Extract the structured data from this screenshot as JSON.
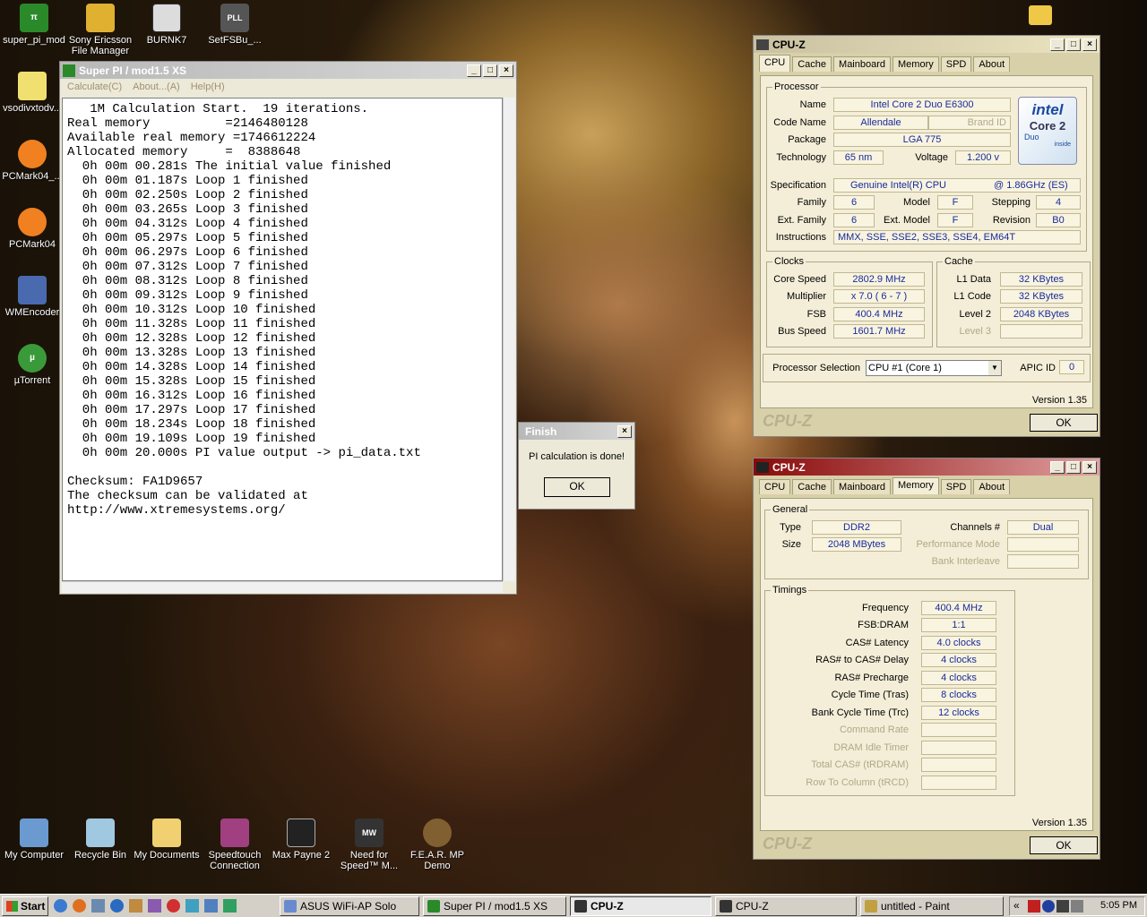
{
  "desktop_icons": {
    "top": [
      "super_pi_mod",
      "Sony Ericsson File Manager",
      "BURNK7",
      "SetFSBu_..."
    ],
    "left": [
      "vsodivxtodv...",
      "PCMark04_...",
      "PCMark04",
      "WMEncoder",
      "µTorrent"
    ],
    "bottom": [
      "My Computer",
      "Recycle Bin",
      "My Documents",
      "Speedtouch Connection",
      "Max Payne 2",
      "Need for Speed™ M...",
      "F.E.A.R. MP Demo"
    ]
  },
  "superpi": {
    "title": "Super PI / mod1.5 XS",
    "menu": [
      "Calculate(C)",
      "About...(A)",
      "Help(H)"
    ],
    "output": "   1M Calculation Start.  19 iterations.\nReal memory          =2146480128\nAvailable real memory =1746612224\nAllocated memory     =  8388648\n  0h 00m 00.281s The initial value finished\n  0h 00m 01.187s Loop 1 finished\n  0h 00m 02.250s Loop 2 finished\n  0h 00m 03.265s Loop 3 finished\n  0h 00m 04.312s Loop 4 finished\n  0h 00m 05.297s Loop 5 finished\n  0h 00m 06.297s Loop 6 finished\n  0h 00m 07.312s Loop 7 finished\n  0h 00m 08.312s Loop 8 finished\n  0h 00m 09.312s Loop 9 finished\n  0h 00m 10.312s Loop 10 finished\n  0h 00m 11.328s Loop 11 finished\n  0h 00m 12.328s Loop 12 finished\n  0h 00m 13.328s Loop 13 finished\n  0h 00m 14.328s Loop 14 finished\n  0h 00m 15.328s Loop 15 finished\n  0h 00m 16.312s Loop 16 finished\n  0h 00m 17.297s Loop 17 finished\n  0h 00m 18.234s Loop 18 finished\n  0h 00m 19.109s Loop 19 finished\n  0h 00m 20.000s PI value output -> pi_data.txt\n\nChecksum: FA1D9657\nThe checksum can be validated at\nhttp://www.xtremesystems.org/"
  },
  "finish": {
    "title": "Finish",
    "message": "PI calculation is done!",
    "ok": "OK"
  },
  "cpuz_tabs": [
    "CPU",
    "Cache",
    "Mainboard",
    "Memory",
    "SPD",
    "About"
  ],
  "cpuz1": {
    "title": "CPU-Z",
    "processor_label": "Processor",
    "name_label": "Name",
    "name": "Intel Core 2 Duo E6300",
    "codename_label": "Code Name",
    "codename": "Allendale",
    "brandid_label": "Brand ID",
    "package_label": "Package",
    "package": "LGA 775",
    "tech_label": "Technology",
    "tech": "65 nm",
    "voltage_label": "Voltage",
    "voltage": "1.200 v",
    "spec_label": "Specification",
    "spec": "Genuine Intel(R) CPU",
    "spec2": "@ 1.86GHz (ES)",
    "family_label": "Family",
    "family": "6",
    "model_label": "Model",
    "model": "F",
    "stepping_label": "Stepping",
    "stepping": "4",
    "extfamily_label": "Ext. Family",
    "extfamily": "6",
    "extmodel_label": "Ext. Model",
    "extmodel": "F",
    "revision_label": "Revision",
    "revision": "B0",
    "instr_label": "Instructions",
    "instr": "MMX, SSE, SSE2, SSE3, SSE4, EM64T",
    "clocks_label": "Clocks",
    "corespeed_label": "Core Speed",
    "corespeed": "2802.9 MHz",
    "mult_label": "Multiplier",
    "mult": "x 7.0  ( 6 - 7 )",
    "fsb_label": "FSB",
    "fsb": "400.4 MHz",
    "bus_label": "Bus Speed",
    "bus": "1601.7 MHz",
    "cache_label": "Cache",
    "l1d_label": "L1 Data",
    "l1d": "32 KBytes",
    "l1c_label": "L1 Code",
    "l1c": "32 KBytes",
    "l2_label": "Level 2",
    "l2": "2048 KBytes",
    "l3_label": "Level 3",
    "procsel_label": "Processor Selection",
    "procsel": "CPU #1 (Core 1)",
    "apic_label": "APIC ID",
    "apic": "0",
    "version": "Version 1.35",
    "logo": "CPU-Z",
    "ok": "OK",
    "intel_logo": {
      "brand": "intel",
      "line1": "Core 2",
      "line2": "Duo",
      "line3": "inside"
    }
  },
  "cpuz2": {
    "title": "CPU-Z",
    "general_label": "General",
    "type_label": "Type",
    "type": "DDR2",
    "channels_label": "Channels #",
    "channels": "Dual",
    "size_label": "Size",
    "size": "2048 MBytes",
    "perfmode_label": "Performance Mode",
    "interleave_label": "Bank Interleave",
    "timings_label": "Timings",
    "timings": [
      {
        "label": "Frequency",
        "value": "400.4 MHz"
      },
      {
        "label": "FSB:DRAM",
        "value": "1:1"
      },
      {
        "label": "CAS# Latency",
        "value": "4.0 clocks"
      },
      {
        "label": "RAS# to CAS# Delay",
        "value": "4 clocks"
      },
      {
        "label": "RAS# Precharge",
        "value": "4 clocks"
      },
      {
        "label": "Cycle Time (Tras)",
        "value": "8 clocks"
      },
      {
        "label": "Bank Cycle Time (Trc)",
        "value": "12 clocks"
      },
      {
        "label": "Command Rate",
        "value": ""
      },
      {
        "label": "DRAM Idle Timer",
        "value": ""
      },
      {
        "label": "Total CAS# (tRDRAM)",
        "value": ""
      },
      {
        "label": "Row To Column (tRCD)",
        "value": ""
      }
    ],
    "version": "Version 1.35",
    "logo": "CPU-Z",
    "ok": "OK"
  },
  "taskbar": {
    "start": "Start",
    "tasks": [
      "ASUS WiFi-AP Solo",
      "Super PI / mod1.5 XS",
      "CPU-Z",
      "CPU-Z",
      "untitled - Paint"
    ],
    "clock": "5:05 PM",
    "tray_chevron": "«"
  }
}
